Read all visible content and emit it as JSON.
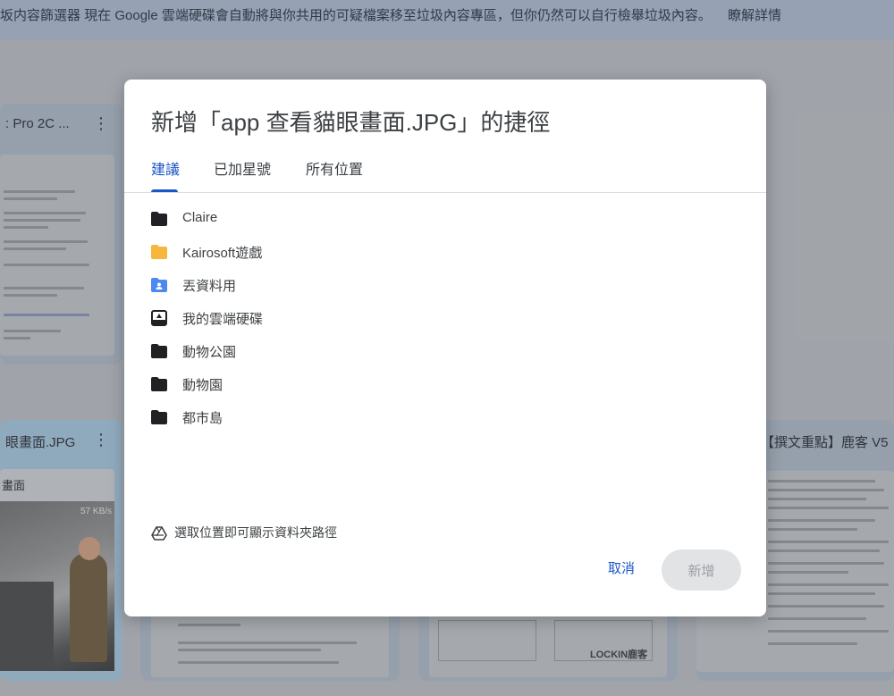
{
  "banner": {
    "text": "坂内容篩選器  現在 Google 雲端硬碟會自動將與你共用的可疑檔案移至垃圾內容專區，但你仍然可以自行檢舉垃圾內容。",
    "link": "瞭解詳情"
  },
  "background_cards": [
    {
      "title": ": Pro 2C ..."
    },
    {
      "title": "眼畫面.JPG",
      "thumb_label": "畫面",
      "overlay": "57 KB/s"
    },
    {
      "title": "【撰文重點】鹿客 V5"
    }
  ],
  "background_thumb_text": {
    "doc_mid": "LOCKIN鹿客"
  },
  "dialog": {
    "title": "新增「app 查看貓眼畫面.JPG」的捷徑",
    "tabs": [
      {
        "label": "建議",
        "active": true
      },
      {
        "label": "已加星號",
        "active": false
      },
      {
        "label": "所有位置",
        "active": false
      }
    ],
    "items": [
      {
        "label": "Claire",
        "icon": "folder-icon",
        "color": "#202124"
      },
      {
        "label": "Kairosoft遊戲",
        "icon": "folder-icon",
        "color": "#f6b73c"
      },
      {
        "label": "丟資料用",
        "icon": "shared-folder-icon",
        "color": "#4d8af0"
      },
      {
        "label": "我的雲端硬碟",
        "icon": "drive-icon",
        "color": "#202124"
      },
      {
        "label": "動物公園",
        "icon": "folder-icon",
        "color": "#202124"
      },
      {
        "label": "動物園",
        "icon": "folder-icon",
        "color": "#202124"
      },
      {
        "label": "都市島",
        "icon": "folder-icon",
        "color": "#202124"
      }
    ],
    "hint": "選取位置即可顯示資料夾路徑",
    "cancel_label": "取消",
    "add_label": "新增"
  },
  "colors": {
    "accent": "#1a56c4",
    "dialog_bg": "#ffffff"
  }
}
